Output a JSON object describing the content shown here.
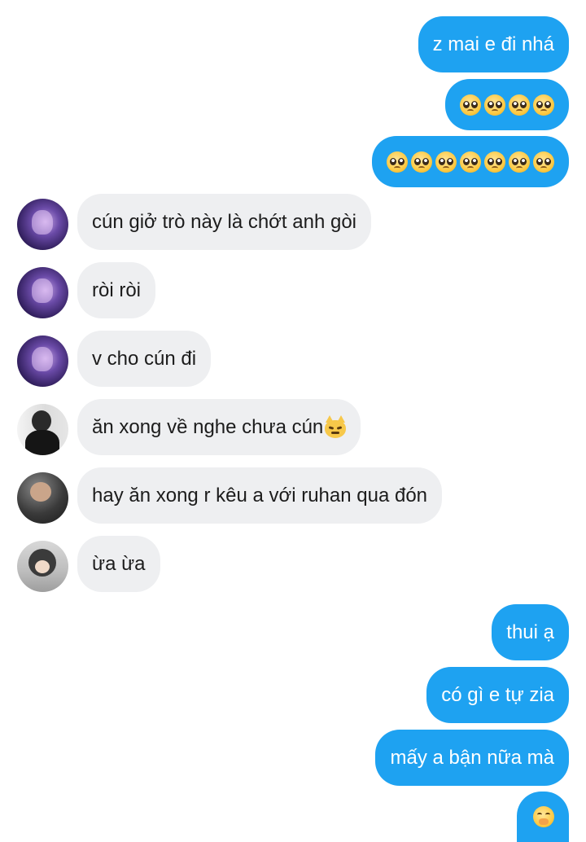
{
  "messages": [
    {
      "direction": "outgoing",
      "text": "z mai e đi nhá"
    },
    {
      "direction": "outgoing",
      "emoji": "pleading-face",
      "emoji_count": 4
    },
    {
      "direction": "outgoing",
      "emoji": "pleading-face",
      "emoji_count": 7
    },
    {
      "direction": "incoming",
      "avatar": "avatar-purple-couple",
      "text": "cún giở trò này là chớt anh gòi"
    },
    {
      "direction": "incoming",
      "avatar": "avatar-purple-couple",
      "text": "ròi ròi"
    },
    {
      "direction": "incoming",
      "avatar": "avatar-purple-couple",
      "text": "v cho cún đi"
    },
    {
      "direction": "incoming",
      "avatar": "avatar-boy-black-shirt",
      "text": "ăn xong về nghe chưa cún",
      "emoji": "pouting-cat-face"
    },
    {
      "direction": "incoming",
      "avatar": "avatar-boy-dark",
      "text": "hay ăn xong r kêu a với ruhan qua đón"
    },
    {
      "direction": "incoming",
      "avatar": "avatar-girl-grey",
      "text": "ừa ừa"
    },
    {
      "direction": "outgoing",
      "text": "thui ạ"
    },
    {
      "direction": "outgoing",
      "text": "có gì e tự zia"
    },
    {
      "direction": "outgoing",
      "text": "mấy a bận nữa mà"
    },
    {
      "direction": "outgoing",
      "emoji": "face-with-hand-over-mouth"
    }
  ],
  "colors": {
    "outgoing_bubble": "#1ea2f1",
    "incoming_bubble": "#eeeff1",
    "outgoing_text": "#ffffff",
    "incoming_text": "#1c1c1c"
  }
}
